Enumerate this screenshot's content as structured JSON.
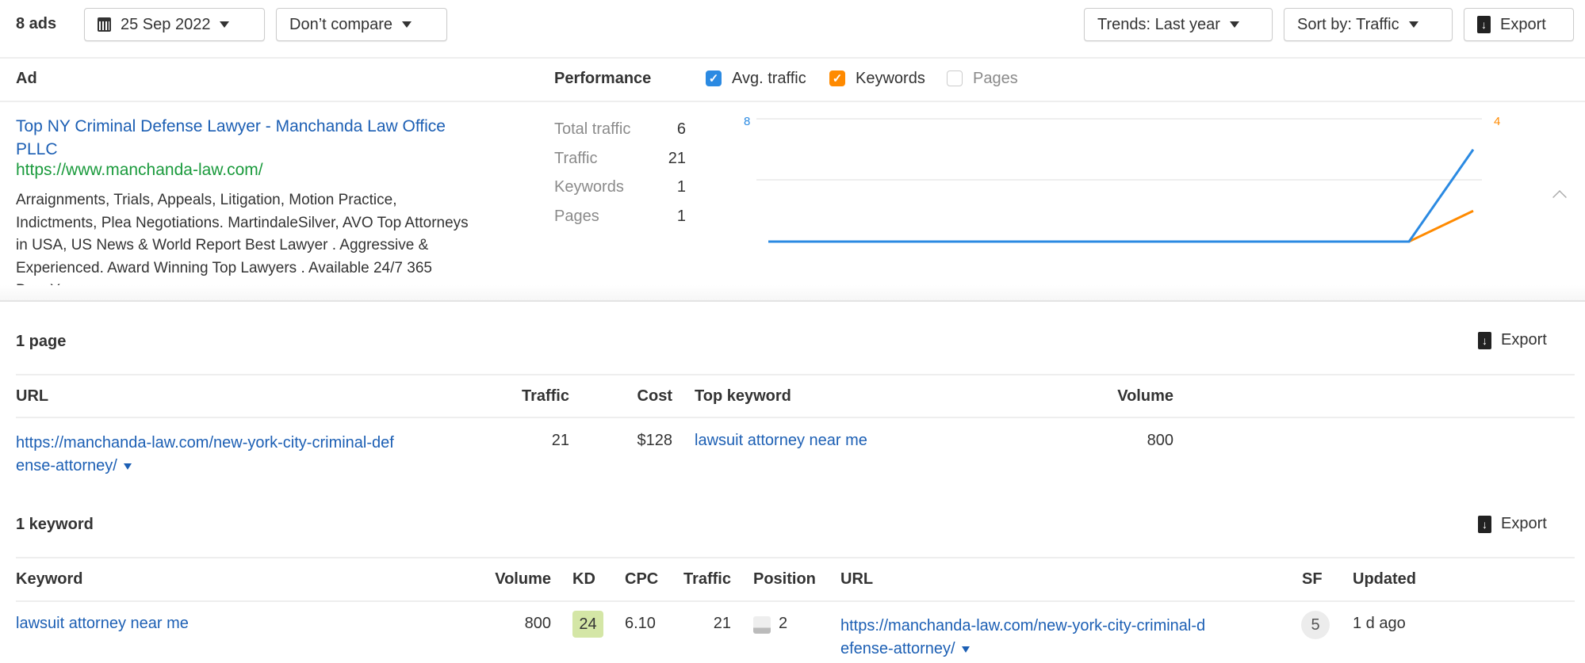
{
  "toolbar": {
    "ads_count": "8 ads",
    "date": "25 Sep 2022",
    "compare": "Don’t compare",
    "trends": "Trends: Last year",
    "sort": "Sort by: Traffic",
    "export": "Export"
  },
  "ads_header": {
    "ad": "Ad",
    "performance": "Performance",
    "legend": [
      {
        "label": "Avg. traffic",
        "checked": true,
        "color": "#2b8ae2"
      },
      {
        "label": "Keywords",
        "checked": true,
        "color": "#ff8a00"
      },
      {
        "label": "Pages",
        "checked": false,
        "color": "#cccccc"
      }
    ]
  },
  "ad": {
    "title_line1": "Top NY Criminal Defense Lawyer - Manchanda Law Office",
    "title_line2": "PLLC",
    "url": "https://www.manchanda-law.com/",
    "description": [
      "Arraignments, Trials, Appeals, Litigation, Motion Practice,",
      "Indictments, Plea Negotiations. MartindaleSilver, AVO Top Attorneys",
      "in USA, US News & World Report Best Lawyer . Aggressive &",
      "Experienced. Award Winning Top Lawyers . Available 24/7 365",
      "DaysYr."
    ],
    "metrics": [
      {
        "label": "Total traffic",
        "value": "6"
      },
      {
        "label": "Traffic",
        "value": "21"
      },
      {
        "label": "Keywords",
        "value": "1"
      },
      {
        "label": "Pages",
        "value": "1"
      }
    ]
  },
  "chart_data": {
    "type": "line",
    "left_axis_max": "8",
    "right_axis_max": "4",
    "series": [
      {
        "name": "Avg. traffic",
        "axis": "left",
        "color": "#2b8ae2",
        "values": [
          0,
          0,
          0,
          0,
          0,
          0,
          0,
          0,
          0,
          0,
          0,
          0,
          6
        ]
      },
      {
        "name": "Keywords",
        "axis": "right",
        "color": "#ff8a00",
        "values": [
          0,
          0,
          0,
          0,
          0,
          0,
          0,
          0,
          0,
          0,
          0,
          0,
          1
        ]
      }
    ],
    "ylim_left": [
      0,
      8
    ],
    "ylim_right": [
      0,
      4
    ]
  },
  "pages": {
    "title": "1 page",
    "export": "Export",
    "headers": {
      "url": "URL",
      "traffic": "Traffic",
      "cost": "Cost",
      "top_keyword": "Top keyword",
      "volume": "Volume"
    },
    "rows": [
      {
        "url_line1": "https://manchanda-law.com/new-york-city-criminal-def",
        "url_line2": "ense-attorney/",
        "traffic": "21",
        "cost": "$128",
        "top_keyword": "lawsuit attorney near me",
        "volume": "800"
      }
    ]
  },
  "keywords": {
    "title": "1 keyword",
    "export": "Export",
    "headers": {
      "keyword": "Keyword",
      "volume": "Volume",
      "kd": "KD",
      "cpc": "CPC",
      "traffic": "Traffic",
      "position": "Position",
      "url": "URL",
      "sf": "SF",
      "updated": "Updated"
    },
    "rows": [
      {
        "keyword": "lawsuit attorney near me",
        "volume": "800",
        "kd": "24",
        "cpc": "6.10",
        "traffic": "21",
        "position": "2",
        "url_line1": "https://manchanda-law.com/new-york-city-criminal-d",
        "url_line2": "efense-attorney/",
        "sf": "5",
        "updated": "1 d ago"
      }
    ]
  }
}
